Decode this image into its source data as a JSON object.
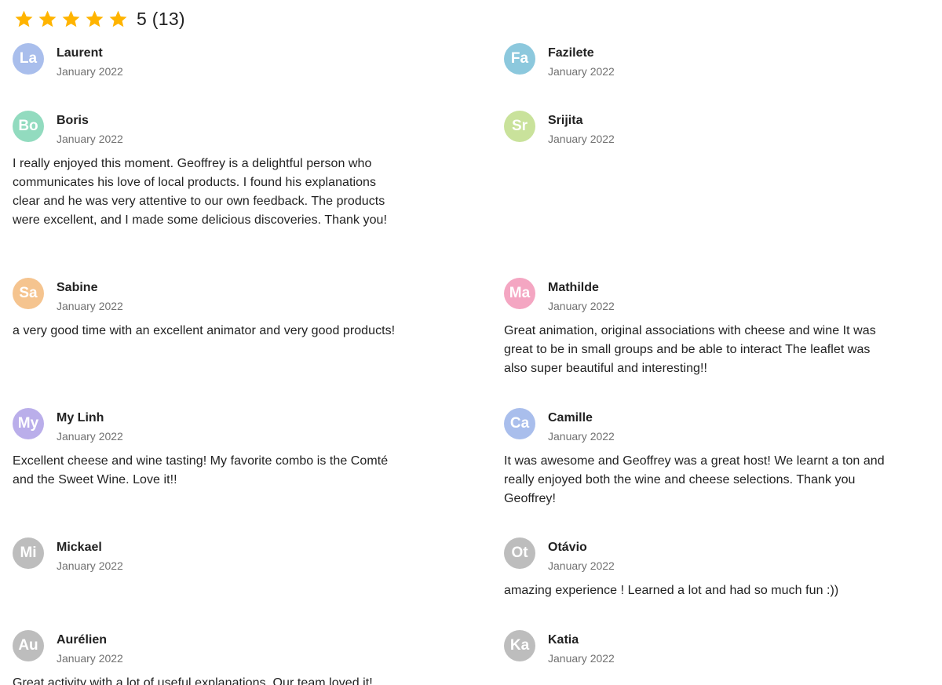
{
  "rating": {
    "stars": 5,
    "summary": "5 (13)",
    "star_color": "#FFB400"
  },
  "reviews": [
    {
      "initials": "La",
      "name": "Laurent",
      "date": "January 2022",
      "text": "",
      "avatar_color": "#A9BEEC"
    },
    {
      "initials": "Fa",
      "name": "Fazilete",
      "date": "January 2022",
      "text": "",
      "avatar_color": "#8CC8DD"
    },
    {
      "initials": "Bo",
      "name": "Boris",
      "date": "January 2022",
      "text": "I really enjoyed this moment. Geoffrey is a delightful person who communicates his love of local products. I found his explanations clear and he was very attentive to our own feedback. The products were excellent, and I made some delicious discoveries. Thank you!",
      "avatar_color": "#92DBBF"
    },
    {
      "initials": "Sr",
      "name": "Srijita",
      "date": "January 2022",
      "text": "",
      "avatar_color": "#C9E29B"
    },
    {
      "initials": "Sa",
      "name": "Sabine",
      "date": "January 2022",
      "text": "a very good time with an excellent animator and very good products!",
      "avatar_color": "#F5C48F"
    },
    {
      "initials": "Ma",
      "name": "Mathilde",
      "date": "January 2022",
      "text": "Great animation, original associations with cheese and wine It was great to be in small groups and be able to interact The leaflet was also super beautiful and interesting!!",
      "avatar_color": "#F4A6C2"
    },
    {
      "initials": "My",
      "name": "My Linh",
      "date": "January 2022",
      "text": "Excellent cheese and wine tasting! My favorite combo is the Comté and the Sweet Wine. Love it!!",
      "avatar_color": "#BAAEEA"
    },
    {
      "initials": "Ca",
      "name": "Camille",
      "date": "January 2022",
      "text": "It was awesome and Geoffrey was a great host! We learnt a ton and really enjoyed both the wine and cheese selections. Thank you Geoffrey!",
      "avatar_color": "#A9BEEC"
    },
    {
      "initials": "Mi",
      "name": "Mickael",
      "date": "January 2022",
      "text": "",
      "avatar_color": "#BDBDBD"
    },
    {
      "initials": "Ot",
      "name": "Otávio",
      "date": "January 2022",
      "text": "amazing experience ! Learned a lot and had so much fun :))",
      "avatar_color": "#BDBDBD"
    },
    {
      "initials": "Au",
      "name": "Aurélien",
      "date": "January 2022",
      "text": "Great activity with a lot of useful explanations. Our team loved it!",
      "avatar_color": "#BDBDBD"
    },
    {
      "initials": "Ka",
      "name": "Katia",
      "date": "January 2022",
      "text": "",
      "avatar_color": "#BDBDBD"
    }
  ]
}
